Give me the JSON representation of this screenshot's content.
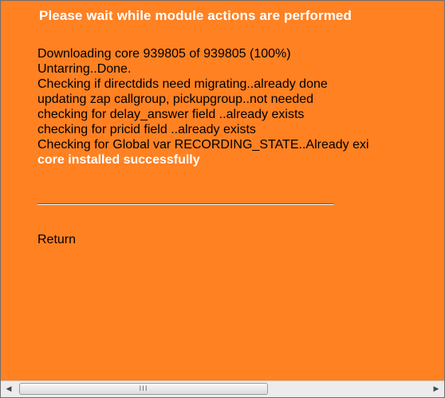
{
  "dialog": {
    "title": "Please wait while module actions are performed",
    "log_lines": [
      "Downloading core 939805 of 939805 (100%)",
      "Untarring..Done.",
      "Checking if directdids need migrating..already done",
      "updating zap callgroup, pickupgroup..not needed",
      "checking for delay_answer field ..already exists",
      "checking for pricid field ..already exists",
      "Checking for Global var RECORDING_STATE..Already exi"
    ],
    "success_message": "core installed successfully",
    "return_link": "Return"
  },
  "scrollbar": {
    "left_arrow": "◀",
    "right_arrow": "▶",
    "grip": "III"
  },
  "colors": {
    "background": "#ff8122",
    "title_text": "#ffffff",
    "log_text": "#000000",
    "success_text": "#ffffff"
  }
}
